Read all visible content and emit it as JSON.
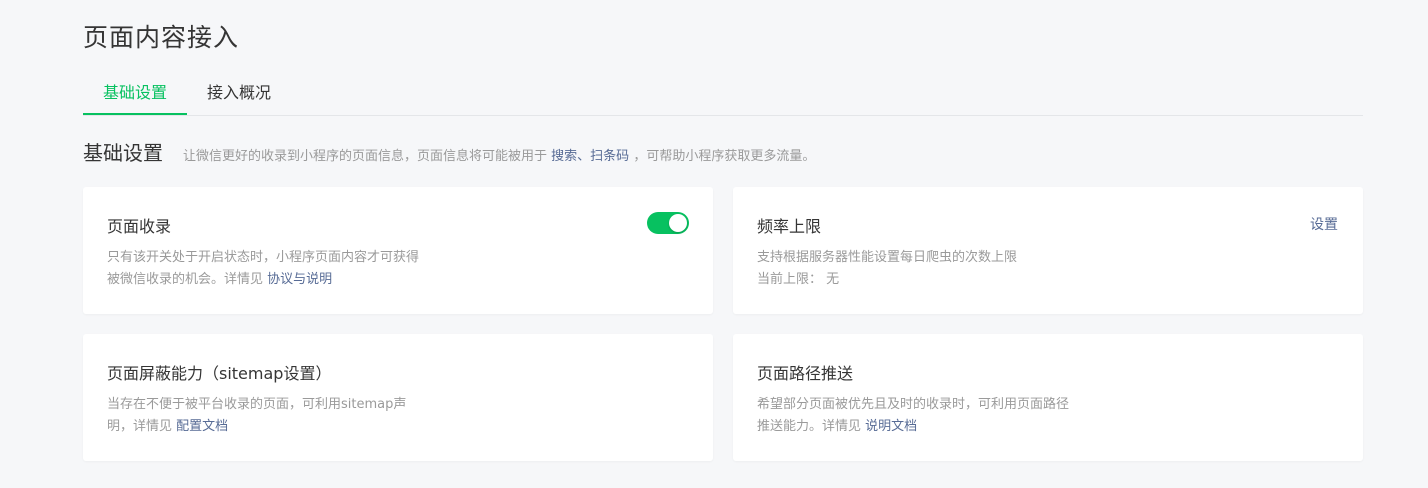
{
  "page": {
    "title": "页面内容接入"
  },
  "tabs": [
    {
      "label": "基础设置",
      "active": true
    },
    {
      "label": "接入概况",
      "active": false
    }
  ],
  "section": {
    "title": "基础设置",
    "desc_prefix": "让微信更好的收录到小程序的页面信息，页面信息将可能被用于",
    "desc_link": "搜索、扫条码",
    "desc_suffix": "，可帮助小程序获取更多流量。"
  },
  "cards": {
    "indexing": {
      "title": "页面收录",
      "toggle_on": true,
      "desc_line1": "只有该开关处于开启状态时，小程序页面内容才可获得",
      "desc_line2_prefix": "被微信收录的机会。详情见",
      "desc_link": "协议与说明"
    },
    "frequency": {
      "title": "频率上限",
      "action": "设置",
      "desc_line1": "支持根据服务器性能设置每日爬虫的次数上限",
      "limit_label": "当前上限：",
      "limit_value": "无"
    },
    "shield": {
      "title": "页面屏蔽能力（sitemap设置）",
      "desc_line1": "当存在不便于被平台收录的页面，可利用sitemap声",
      "desc_line2_prefix": "明，详情见",
      "desc_link": "配置文档"
    },
    "push": {
      "title": "页面路径推送",
      "desc_line1": "希望部分页面被优先且及时的收录时，可利用页面路径",
      "desc_line2_prefix": "推送能力。详情见",
      "desc_link": "说明文档"
    }
  },
  "colors": {
    "accent": "#07c160",
    "link": "#576b95",
    "background": "#f6f7f9",
    "text": "#353535",
    "muted": "#9a9a9a"
  }
}
